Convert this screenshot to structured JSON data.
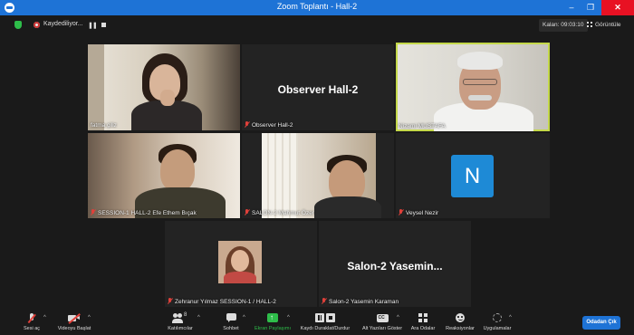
{
  "window": {
    "title": "Zoom Toplantı - Hall-2",
    "minimize": "–",
    "maximize": "❐",
    "close": "✕"
  },
  "topbar": {
    "recording_label": "Kaydediliyor...",
    "timer": "Kalan: 09:03:10",
    "view_label": "Görüntüle"
  },
  "tiles": {
    "t1": {
      "name": "fatma çiliz"
    },
    "t2": {
      "title": "Observer Hall-2",
      "name": "Observer Hall-2"
    },
    "t3": {
      "name": "Nizami MUSTAFA"
    },
    "t4": {
      "name": "SESSION-1 HALL-2 Efe Ethem Bıçak"
    },
    "t5": {
      "name": "SALON-2 Mahmut Özer"
    },
    "t6": {
      "initial": "N",
      "name": "Veysel Nezir"
    },
    "t7": {
      "name": "Zehranur Yılmaz SESSION-1 / HALL-2"
    },
    "t8": {
      "title": "Salon-2  Yasemin...",
      "name": "Salon-2 Yasemin Karaman"
    }
  },
  "toolbar": {
    "mute": "Sesi aç",
    "video": "Videoyu Başlat",
    "participants": "Katılımcılar",
    "participants_count": "8",
    "chat": "Sohbet",
    "share": "Ekran Paylaşımı",
    "record": "Kaydı Duraklat/Durdur",
    "captions": "Alt Yazıları Göster",
    "breakout": "Ara Odalar",
    "reactions": "Reaksiyonlar",
    "apps": "Uygulamalar",
    "leave": "Odadan Çık"
  },
  "colors": {
    "accent": "#1e73d6",
    "active_speaker": "#c4d84a",
    "muted": "#e0403a",
    "share": "#2ebd4a"
  }
}
